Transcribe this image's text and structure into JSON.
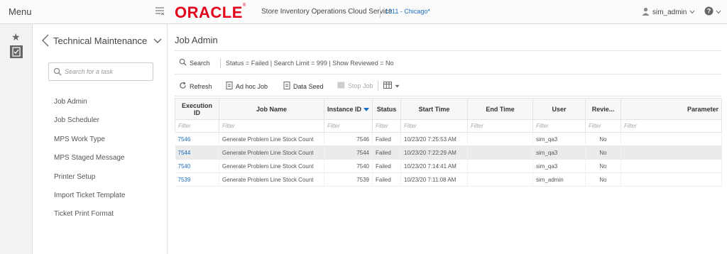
{
  "header": {
    "menu_label": "Menu",
    "logo_text": "ORACLE",
    "logo_tm": "®",
    "app_title": "Store Inventory Operations Cloud Service",
    "store": "1311 - Chicago*",
    "user": "sim_admin",
    "user_icon": "user-icon",
    "help_icon": "help-icon",
    "colors": {
      "brand": "#e2001a",
      "link": "#1a6ec1"
    }
  },
  "rail": {
    "icons": [
      "star-icon",
      "task-list-icon"
    ]
  },
  "task_panel": {
    "title": "Technical Maintenance",
    "search_placeholder": "Search for a task",
    "items": [
      {
        "label": "Job Admin"
      },
      {
        "label": "Job Scheduler"
      },
      {
        "label": "MPS Work Type"
      },
      {
        "label": "MPS Staged Message"
      },
      {
        "label": "Printer Setup"
      },
      {
        "label": "Import Ticket Template"
      },
      {
        "label": "Ticket Print Format"
      }
    ]
  },
  "main": {
    "page_title": "Job Admin",
    "search_label": "Search",
    "criteria": "Status = Failed | Search Limit = 999 | Show Reviewed = No",
    "toolbar": {
      "refresh": "Refresh",
      "adhoc": "Ad hoc Job",
      "dataseed": "Data Seed",
      "stopjob": "Stop Job"
    },
    "grid": {
      "columns": [
        "Execution ID",
        "Job Name",
        "Instance ID",
        "Status",
        "Start Time",
        "End Time",
        "User",
        "Revie...",
        "Parameter"
      ],
      "filter_placeholder": "Filter",
      "sorted_column": "Instance ID",
      "rows": [
        {
          "execution_id": "7546",
          "job_name": "Generate Problem Line Stock Count",
          "instance_id": "7546",
          "status": "Failed",
          "start_time": "10/23/20 7:25:53 AM",
          "end_time": "",
          "user": "sim_qa3",
          "reviewed": "No",
          "parameter": ""
        },
        {
          "execution_id": "7544",
          "job_name": "Generate Problem Line Stock Count",
          "instance_id": "7544",
          "status": "Failed",
          "start_time": "10/23/20 7:22:29 AM",
          "end_time": "",
          "user": "sim_qa3",
          "reviewed": "No",
          "parameter": ""
        },
        {
          "execution_id": "7540",
          "job_name": "Generate Problem Line Stock Count",
          "instance_id": "7540",
          "status": "Failed",
          "start_time": "10/23/20 7:14:41 AM",
          "end_time": "",
          "user": "sim_qa3",
          "reviewed": "No",
          "parameter": ""
        },
        {
          "execution_id": "7539",
          "job_name": "Generate Problem Line Stock Count",
          "instance_id": "7539",
          "status": "Failed",
          "start_time": "10/23/20 7:11:08 AM",
          "end_time": "",
          "user": "sim_admin",
          "reviewed": "No",
          "parameter": ""
        }
      ]
    }
  }
}
